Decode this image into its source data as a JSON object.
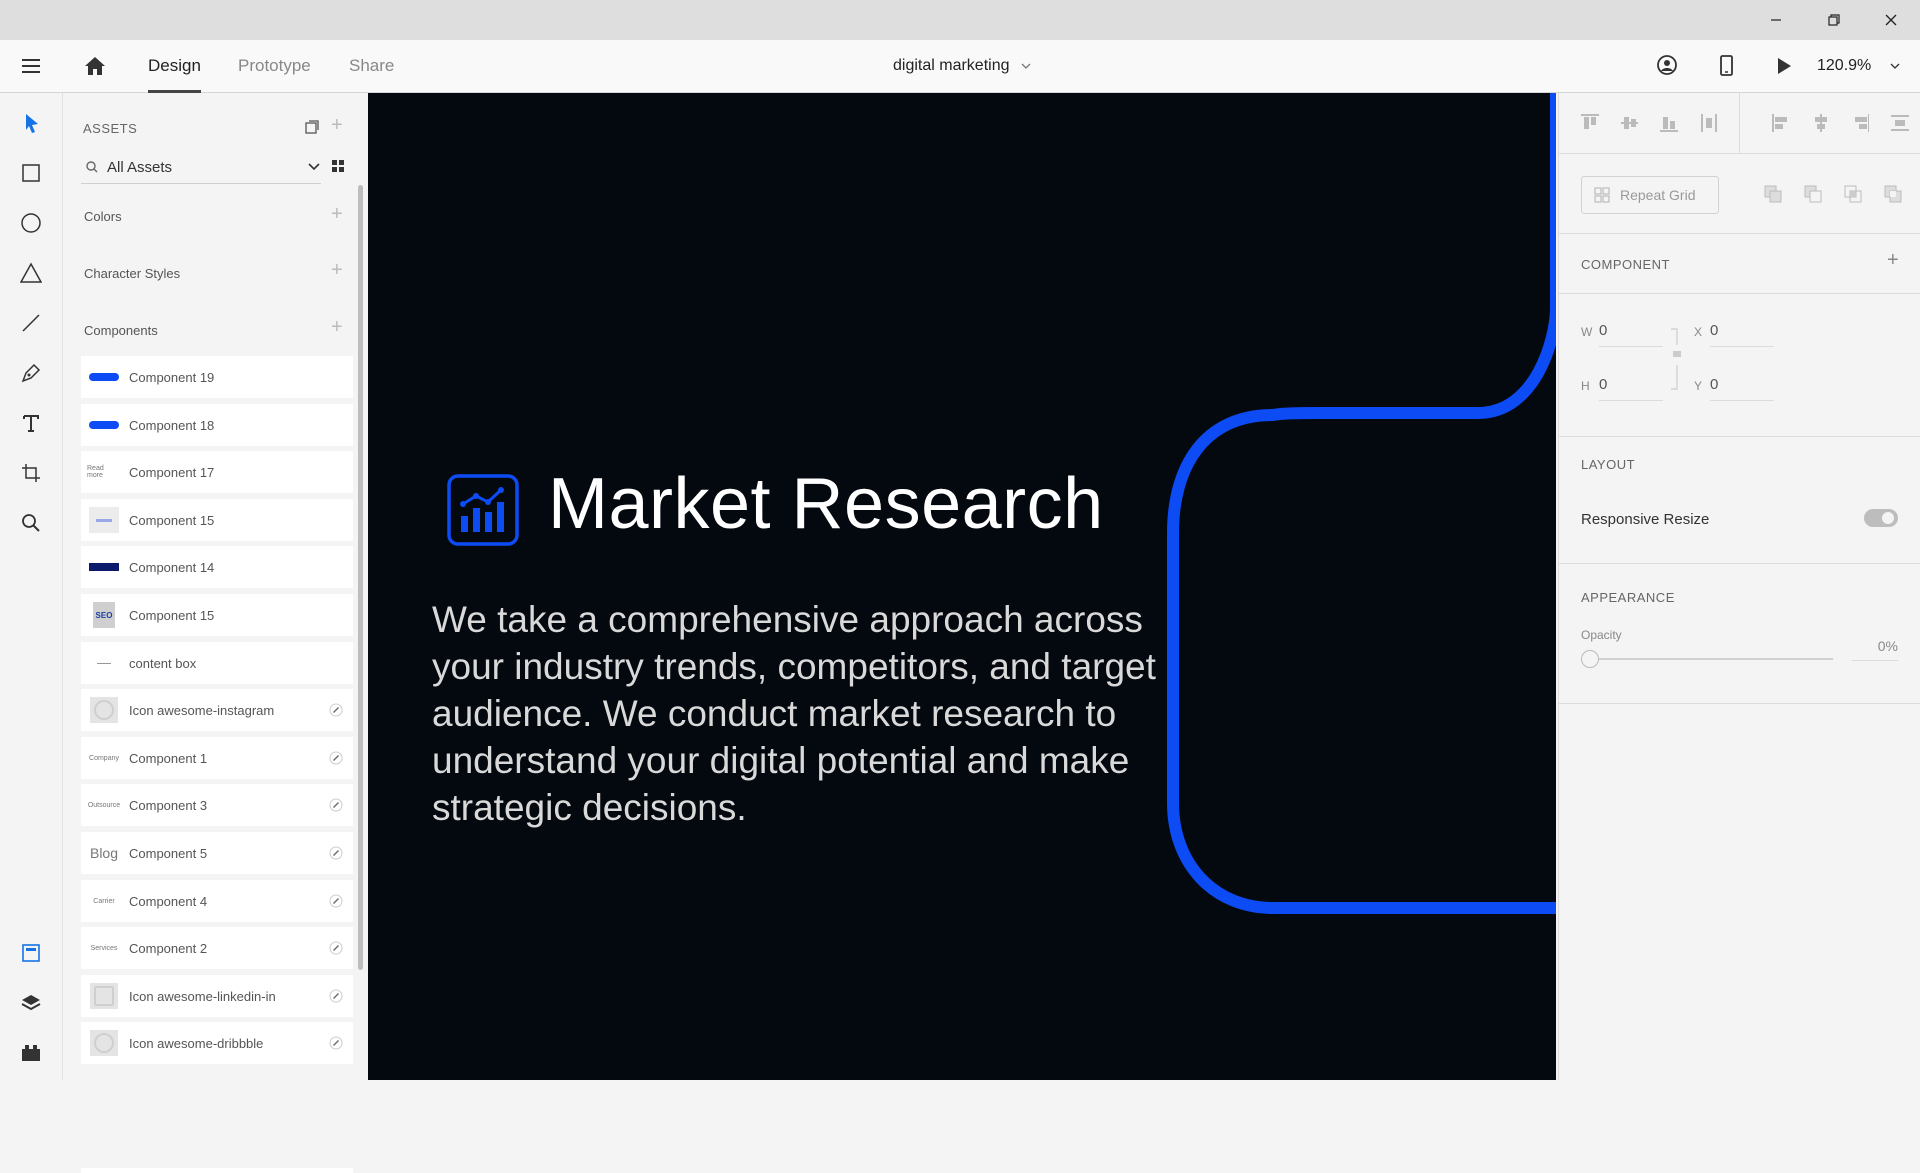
{
  "window": {
    "controls": [
      "minimize",
      "restore",
      "close"
    ]
  },
  "header": {
    "tabs": [
      {
        "label": "Design",
        "active": true
      },
      {
        "label": "Prototype",
        "active": false
      },
      {
        "label": "Share",
        "active": false
      }
    ],
    "document_title": "digital marketing",
    "zoom": "120.9%"
  },
  "toolbar": {
    "tools": [
      "select-icon",
      "rectangle-icon",
      "ellipse-icon",
      "polygon-icon",
      "line-icon",
      "pen-icon",
      "text-icon",
      "artboard-icon",
      "zoom-icon"
    ],
    "bottom": [
      "assets-icon",
      "layers-icon",
      "plugins-icon"
    ]
  },
  "assets": {
    "title": "ASSETS",
    "filter": "All Assets",
    "sections": {
      "colors": "Colors",
      "character_styles": "Character Styles",
      "components": "Components"
    },
    "items": [
      {
        "label": "Component 19",
        "thumb": "btn-blue",
        "linked": false
      },
      {
        "label": "Component 18",
        "thumb": "btn-blue",
        "linked": false
      },
      {
        "label": "Component 17",
        "thumb": "text-small",
        "thumb_text": "Read more",
        "linked": false
      },
      {
        "label": "Component 15",
        "thumb": "btn-light",
        "linked": false
      },
      {
        "label": "Component 14",
        "thumb": "btn-navy",
        "linked": false
      },
      {
        "label": "Component 15",
        "thumb": "seo",
        "thumb_text": "SEO",
        "linked": false
      },
      {
        "label": "content box",
        "thumb": "dash",
        "linked": false
      },
      {
        "label": "Icon awesome-instagram",
        "thumb": "instagram",
        "linked": true
      },
      {
        "label": "Component 1",
        "thumb": "text-small",
        "thumb_text": "Company",
        "linked": true
      },
      {
        "label": "Component 3",
        "thumb": "text-small",
        "thumb_text": "Outsource",
        "linked": true
      },
      {
        "label": "Component 5",
        "thumb": "text-large",
        "thumb_text": "Blog",
        "linked": true
      },
      {
        "label": "Component 4",
        "thumb": "text-small",
        "thumb_text": "Carrier",
        "linked": true
      },
      {
        "label": "Component 2",
        "thumb": "text-small",
        "thumb_text": "Services",
        "linked": true
      },
      {
        "label": "Icon awesome-linkedin-in",
        "thumb": "linkedin",
        "linked": true
      },
      {
        "label": "Icon awesome-dribbble",
        "thumb": "dribbble",
        "linked": true
      }
    ]
  },
  "canvas": {
    "heading": "Market Research",
    "paragraph": "We take a comprehensive approach across your industry trends, competitors, and target audience. We conduct market research to understand your digital potential and make strategic decisions.",
    "accent": "#0d4cf5",
    "background": "#04080f"
  },
  "properties": {
    "repeat_grid": "Repeat Grid",
    "component_title": "COMPONENT",
    "w_label": "W",
    "w_value": "0",
    "h_label": "H",
    "h_value": "0",
    "x_label": "X",
    "x_value": "0",
    "y_label": "Y",
    "y_value": "0",
    "layout_title": "LAYOUT",
    "responsive_resize": "Responsive Resize",
    "appearance_title": "APPEARANCE",
    "opacity_label": "Opacity",
    "opacity_value": "0%",
    "opacity_level": 0
  }
}
